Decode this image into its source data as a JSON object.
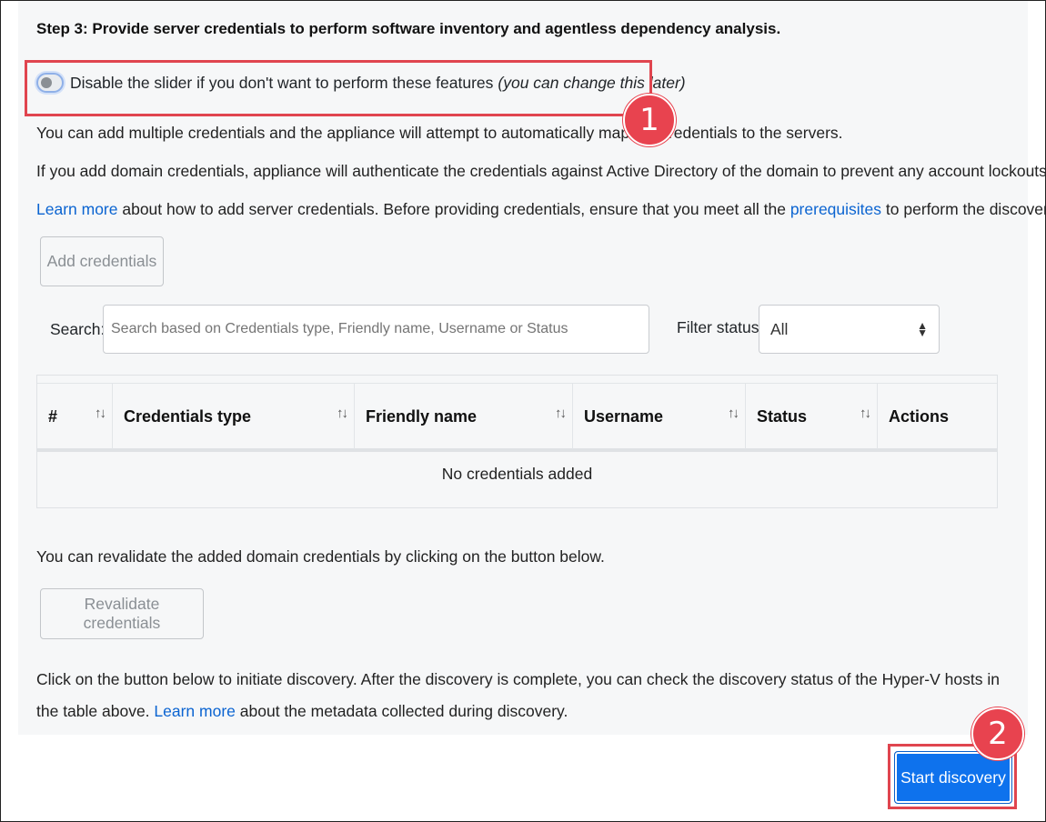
{
  "step_title": "Step 3: Provide server credentials to perform software inventory and agentless dependency analysis.",
  "toggle": {
    "label": "Disable the slider if you don't want to perform these features",
    "hint": "(you can change this later)"
  },
  "para1": "You can add multiple credentials and the appliance will attempt to automatically map the credentials to the servers.",
  "para2": "If you add domain credentials, appliance will authenticate the credentials against Active Directory of the domain to prevent any account lockouts.",
  "para3": {
    "link1": "Learn more",
    "text1": " about how to add server credentials. Before providing credentials, ensure that you meet all the ",
    "link2": "prerequisites",
    "text2": " to perform the discovery."
  },
  "add_credentials_label": "Add credentials",
  "search": {
    "label": "Search:",
    "placeholder": "Search based on Credentials type, Friendly name, Username or Status"
  },
  "filter": {
    "label": "Filter status",
    "selected": "All"
  },
  "table": {
    "columns": [
      "#",
      "Credentials type",
      "Friendly name",
      "Username",
      "Status",
      "Actions"
    ],
    "empty_text": "No credentials added"
  },
  "para4": "You can revalidate the added domain credentials by clicking on the button below.",
  "revalidate_label": "Revalidate credentials",
  "para5": {
    "text1": "Click on the button below to initiate discovery. After the discovery is complete, you can check the discovery status of the Hyper-V hosts in the table above. ",
    "link": "Learn more",
    "text2": " about the metadata collected during discovery."
  },
  "start_discovery_label": "Start discovery",
  "callouts": [
    "1",
    "2"
  ],
  "colors": {
    "accent": "#0e72ed",
    "link": "#0b64d1",
    "highlight": "#e0454f"
  }
}
